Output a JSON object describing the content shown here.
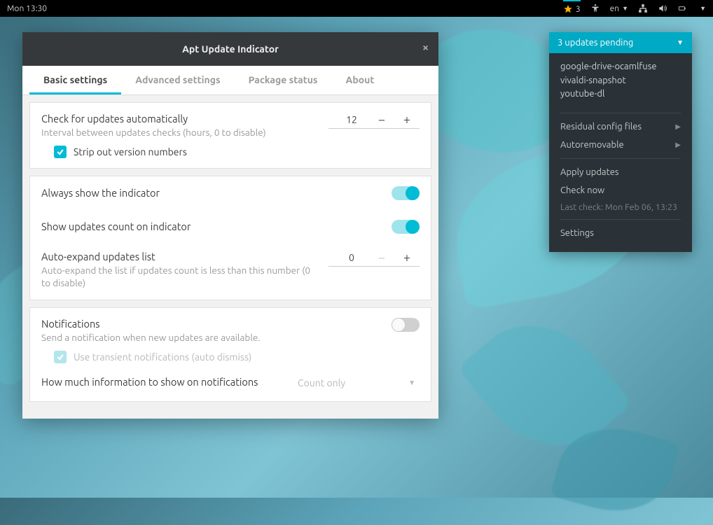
{
  "panel": {
    "clock": "Mon 13:30",
    "updates_count": "3",
    "lang": "en"
  },
  "dialog": {
    "title": "Apt Update Indicator",
    "tabs": {
      "basic": "Basic settings",
      "advanced": "Advanced settings",
      "package": "Package status",
      "about": "About"
    },
    "check_updates": {
      "title": "Check for updates automatically",
      "desc": "Interval between updates checks (hours, 0 to disable)",
      "value": "12",
      "strip": "Strip out version numbers"
    },
    "always_show": "Always show the indicator",
    "show_count": "Show updates count on indicator",
    "auto_expand": {
      "title": "Auto-expand updates list",
      "desc": "Auto-expand the list if updates count is less than this number (0 to disable)",
      "value": "0"
    },
    "notifications": {
      "title": "Notifications",
      "desc": "Send a notification when new updates are available.",
      "transient": "Use transient notifications (auto dismiss)"
    },
    "how_much": {
      "title": "How much information to show on notifications",
      "value": "Count only"
    }
  },
  "popup": {
    "header": "3 updates pending",
    "packages": [
      "google-drive-ocamlfuse",
      "vivaldi-snapshot",
      "youtube-dl"
    ],
    "residual": "Residual config files",
    "autoremove": "Autoremovable",
    "apply": "Apply updates",
    "check_now": "Check now",
    "last_check": "Last check: Mon Feb 06, 13:23",
    "settings": "Settings"
  }
}
